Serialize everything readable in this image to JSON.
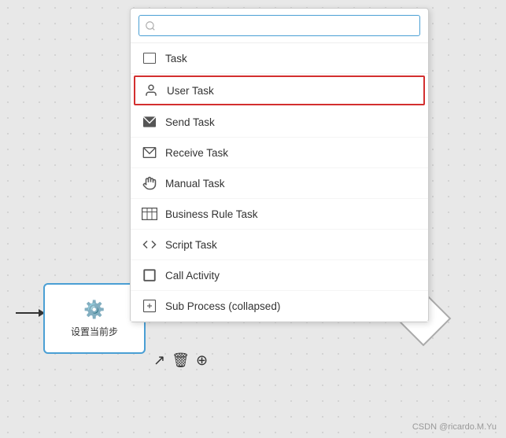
{
  "search": {
    "placeholder": "🔍"
  },
  "dropdown": {
    "items": [
      {
        "id": "task",
        "label": "Task",
        "icon": "task"
      },
      {
        "id": "user-task",
        "label": "User Task",
        "icon": "user",
        "highlighted": true
      },
      {
        "id": "send-task",
        "label": "Send Task",
        "icon": "send"
      },
      {
        "id": "receive-task",
        "label": "Receive Task",
        "icon": "receive"
      },
      {
        "id": "manual-task",
        "label": "Manual Task",
        "icon": "manual"
      },
      {
        "id": "business-rule-task",
        "label": "Business Rule Task",
        "icon": "business"
      },
      {
        "id": "script-task",
        "label": "Script Task",
        "icon": "script"
      },
      {
        "id": "call-activity",
        "label": "Call Activity",
        "icon": "call"
      },
      {
        "id": "sub-process",
        "label": "Sub Process (collapsed)",
        "icon": "subprocess"
      }
    ]
  },
  "node": {
    "label": "设置当前步",
    "icon": "⚙️"
  },
  "watermark": {
    "text": "CSDN @ricardo.M.Yu"
  },
  "toolbar": {
    "icons": [
      "↗",
      "🗑",
      "⊕"
    ]
  }
}
